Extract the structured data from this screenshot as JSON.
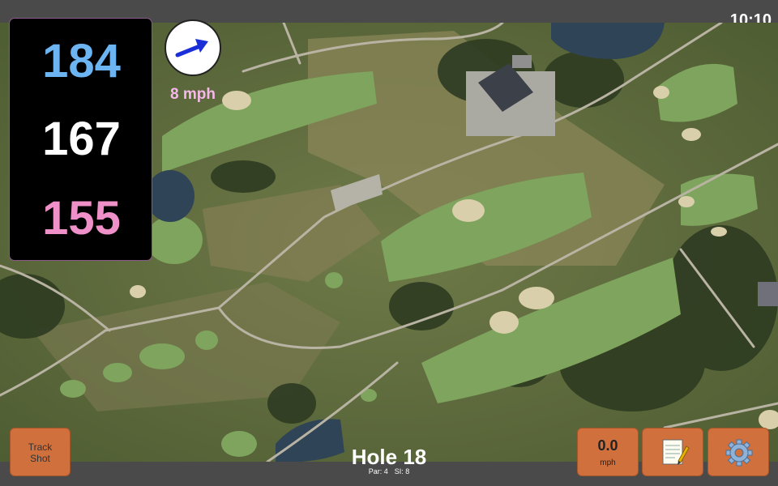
{
  "status_bar": {
    "time": "10:10"
  },
  "distances": {
    "back": "184",
    "center": "167",
    "front": "155",
    "colors": {
      "back": "#6db5f2",
      "center": "#ffffff",
      "front": "#f090c8"
    }
  },
  "wind": {
    "speed_label": "8 mph",
    "direction_icon": "arrow-right-icon",
    "label_color": "#f6b8ea"
  },
  "buttons": {
    "track_shot": {
      "line1": "Track",
      "line2": "Shot"
    },
    "speed": {
      "value": "0.0",
      "unit": "mph"
    },
    "notes": {
      "icon": "notepad-icon"
    },
    "settings": {
      "icon": "gear-icon"
    }
  },
  "hole": {
    "title": "Hole 18",
    "par": "Par: 4",
    "si": "SI: 8"
  },
  "colors": {
    "accent_button": "#d0703d",
    "bar": "#4a4a4a"
  }
}
